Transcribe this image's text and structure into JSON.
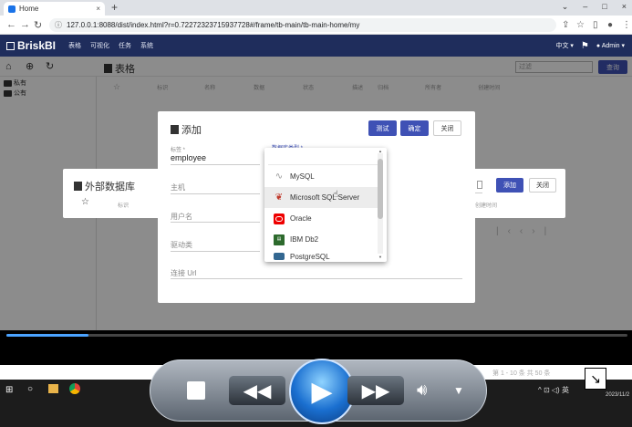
{
  "browser": {
    "tab_title": "Home",
    "tab_close": "×",
    "new_tab": "+",
    "url": "127.0.0.1:8088/dist/index.html?r=0.72272323715937728#/frame/tb-main/tb-main-home/my",
    "win_min": "⌄",
    "win_minimize": "–",
    "win_max": "□",
    "win_close": "×"
  },
  "app": {
    "logo": "BriskBI",
    "menu": [
      "表格",
      "可视化",
      "任务",
      "系统"
    ],
    "lang_label": "中文",
    "user": "Admin"
  },
  "sidebar": {
    "items": [
      "私有",
      "公有"
    ]
  },
  "table": {
    "title": "表格",
    "filter_placeholder": "过滤",
    "search_button": "查询",
    "columns": [
      "标识",
      "名称",
      "数据",
      "状态",
      "描述",
      "归档",
      "所有者",
      "创建时间"
    ]
  },
  "external_dialog": {
    "title": "外部数据库",
    "add_button": "添加",
    "close_button": "关闭",
    "col_id": "标识",
    "col_created": "创建时间",
    "col_db": "据库"
  },
  "add_dialog": {
    "title": "添加",
    "test_button": "测试",
    "confirm_button": "确定",
    "close_button": "关闭",
    "fields": {
      "id_label": "标签 *",
      "id_value": "employee",
      "type_label": "数据库类型 *",
      "host_label": "主机",
      "user_label": "用户名",
      "driver_label": "驱动类",
      "url_label": "连接 Url"
    }
  },
  "dropdown": {
    "options": [
      "MySQL",
      "Microsoft SQL Server",
      "Oracle",
      "IBM Db2",
      "PostgreSQL"
    ]
  },
  "pager": {
    "text": "第 1 - 10 条 共 50 条"
  },
  "taskbar": {
    "time": "2023/11/2",
    "tray": "英"
  },
  "colors": {
    "header_bg": "#1f2d5c",
    "primary": "#3f51b5"
  }
}
